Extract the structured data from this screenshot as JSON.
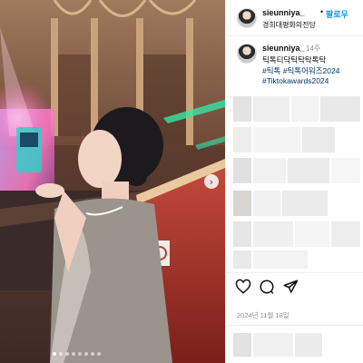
{
  "header": {
    "username": "sieunniya_",
    "separator": "•",
    "follow_label": "팔로우",
    "location": "경희대평화의전당"
  },
  "caption": {
    "username": "sieunniya_",
    "time_ago": "14주",
    "text": "틱톡티닥틱탁탁톡탁",
    "hashtags_line1": "#틱톡 #틱톡어워즈2024",
    "hashtags_line2": "#Tiktokawards2024"
  },
  "post_date": "2024년 11월 18일",
  "icons": {
    "next": "chevron-right-icon",
    "like": "heart-icon",
    "comment": "comment-icon",
    "share": "share-icon"
  },
  "carousel": {
    "total": 8,
    "active_index": 0
  },
  "colors": {
    "follow": "#0095f6",
    "hashtag": "#00376b",
    "muted": "#8e8e8e",
    "stage_pink": "#ff4fa3",
    "stage_green": "#34e6a4",
    "balcony_red": "#b4382f"
  }
}
